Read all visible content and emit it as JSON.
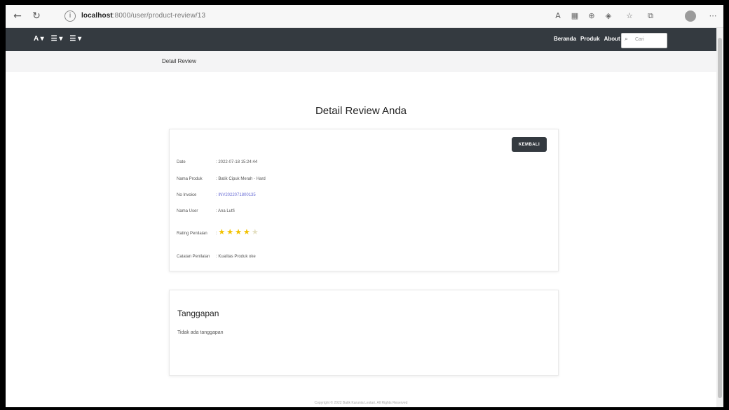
{
  "browser": {
    "url_host": "localhost",
    "url_rest": ":8000/user/product-review/13"
  },
  "navbar": {
    "left_items": [
      "A ▾",
      "☰ ▾",
      "☰ ▾"
    ],
    "links": [
      "Beranda",
      "Produk",
      "About Us"
    ],
    "search_placeholder": "Cari"
  },
  "breadcrumb": "Detail Review",
  "page_title": "Detail Review Anda",
  "detail": {
    "back_label": "KEMBALI",
    "rows": [
      {
        "label": "Date",
        "value": ": 2022-07-18 15:24:44"
      },
      {
        "label": "Nama Produk",
        "value": ": Batik Cipuk Merah - Hard"
      },
      {
        "label": "No Invoice",
        "value": ": INV2022071800135"
      },
      {
        "label": "Nama User",
        "value": ": Ana Lutfi"
      },
      {
        "label": "Rating Penilaian",
        "value": ":"
      },
      {
        "label": "Catatan Penilaian",
        "value": ": Kualitas Produk oke"
      }
    ],
    "rating": 4,
    "rating_max": 5
  },
  "response": {
    "title": "Tanggapan",
    "text": "Tidak ada tanggapan"
  },
  "footer": "Copyright © 2022 Batik Karunia Lestari. All Rights Reserved"
}
